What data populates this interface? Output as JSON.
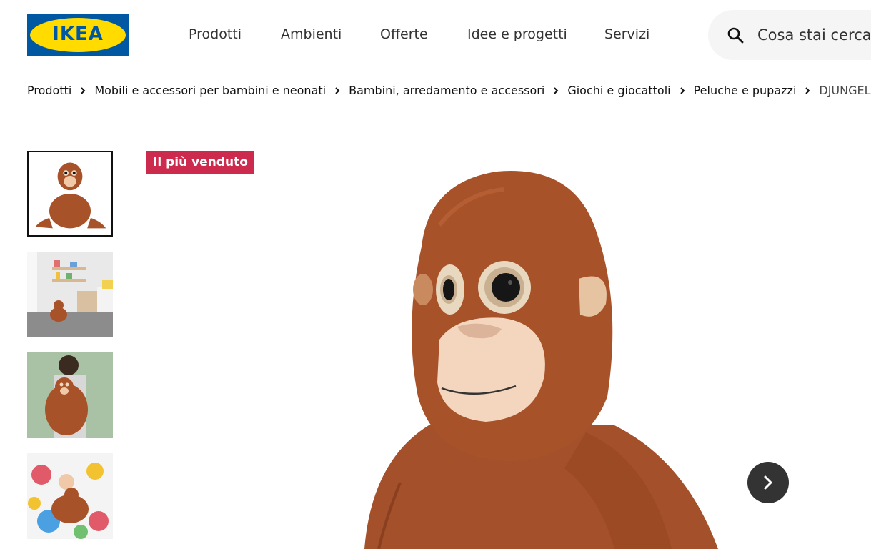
{
  "header": {
    "logo_text": "IKEA",
    "nav": [
      "Prodotti",
      "Ambienti",
      "Offerte",
      "Idee e progetti",
      "Servizi"
    ],
    "search": {
      "placeholder": "Cosa stai cercando?",
      "icon": "search-icon"
    }
  },
  "breadcrumb": [
    "Prodotti",
    "Mobili e accessori per bambini e neonati",
    "Bambini, arredamento e accessori",
    "Giochi e giocattoli",
    "Peluche e pupazzi",
    "DJUNGELSKOG"
  ],
  "badge": "Il più venduto",
  "gallery": {
    "thumbnails": [
      "product-thumb-1",
      "product-thumb-2",
      "product-thumb-3",
      "product-thumb-4"
    ],
    "selected_index": 0,
    "next_icon": "chevron-right-icon"
  },
  "colors": {
    "ikea_blue": "#0058a3",
    "ikea_yellow": "#ffdb00",
    "badge": "#cc2b4e",
    "plush_brown": "#a8522a"
  }
}
